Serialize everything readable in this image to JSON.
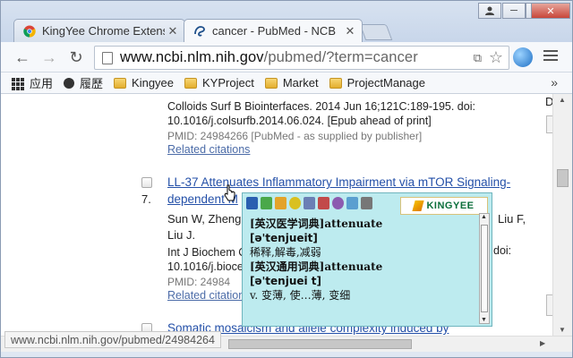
{
  "tabs": [
    {
      "title": "KingYee Chrome Extens",
      "active": false
    },
    {
      "title": "cancer - PubMed - NCB",
      "active": true
    }
  ],
  "window_controls": {
    "minimize": "─",
    "maximize": "□",
    "close": "✕"
  },
  "address_bar": {
    "host": "www.ncbi.nlm.nih.gov",
    "path": "/pubmed/?term=cancer"
  },
  "bookmarks": [
    "应用",
    "履歷",
    "Kingyee",
    "KYProject",
    "Market",
    "ProjectManage"
  ],
  "bookmarks_more": "»",
  "results": {
    "prev": {
      "citation_line1": "Colloids Surf B Biointerfaces. 2014 Jun 16;121C:189-195. doi:",
      "citation_line2": "10.1016/j.colsurfb.2014.06.024. [Epub ahead of print]",
      "pmid": "PMID: 24984266 [PubMed - as supplied by publisher]",
      "related": "Related citations"
    },
    "item7": {
      "number": "7.",
      "title_line1": "LL-37 Attenuates Inflammatory Impairment via mTOR Signaling-",
      "title_line2": "dependent M",
      "authors_line1": "Sun W, Zheng",
      "authors_right": "Liu F,",
      "authors_line2": "Liu J.",
      "citation_line1": "Int J Biochem C",
      "citation_right": "doi:",
      "citation_line2": "10.1016/j.bioce",
      "pmid": "PMID: 24984",
      "related": "Related citation"
    },
    "item8": {
      "title_line1": "Somatic mosaicism and allele complexity induced by"
    }
  },
  "right_frag": {
    "d": "D"
  },
  "status_url": "www.ncbi.nlm.nih.gov/pubmed/24984264",
  "popup": {
    "logo": "KINGYEE",
    "entry1_header": "[英汉医学词典]attenuate",
    "entry1_phonetic": "[ə'tenjueit]",
    "entry1_def": "稀释,解毒,减弱",
    "entry2_header": "[英汉通用词典]attenuate",
    "entry2_phonetic": "[ə'tenjuei t]",
    "entry2_def": "v. 变薄, 使…薄, 变细"
  },
  "colors": {
    "link": "#2450a8",
    "popup_bg": "#bdebef",
    "related": "#4c6ca8"
  }
}
